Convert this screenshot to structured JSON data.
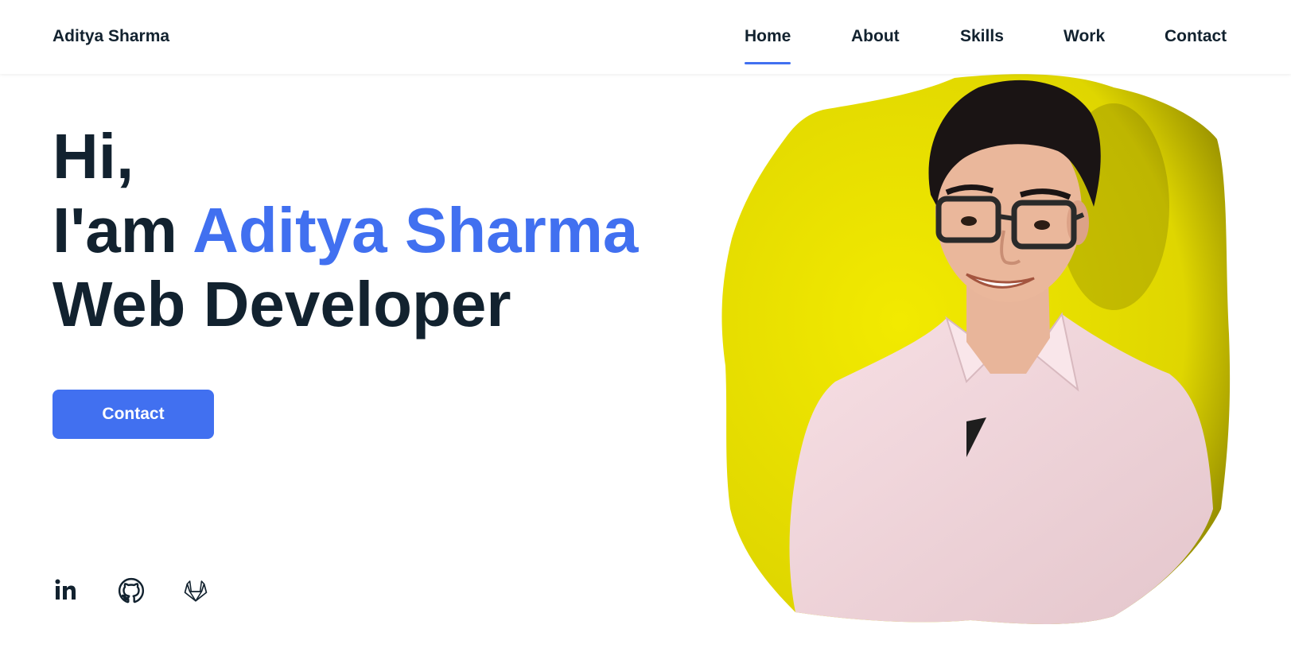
{
  "header": {
    "logo": "Aditya Sharma",
    "nav": [
      {
        "label": "Home",
        "active": true
      },
      {
        "label": "About",
        "active": false
      },
      {
        "label": "Skills",
        "active": false
      },
      {
        "label": "Work",
        "active": false
      },
      {
        "label": "Contact",
        "active": false
      }
    ]
  },
  "hero": {
    "line1": "Hi,",
    "line2_prefix": "I'am ",
    "line2_name": "Aditya Sharma",
    "line3": "Web Developer",
    "cta_label": "Contact"
  },
  "social": [
    {
      "icon": "linkedin-icon",
      "label": "in"
    },
    {
      "icon": "github-icon"
    },
    {
      "icon": "gitlab-icon"
    }
  ],
  "colors": {
    "accent": "#4170f0",
    "text": "#12222f",
    "blob": "#e6de00",
    "shirt": "#f3d7dd"
  }
}
